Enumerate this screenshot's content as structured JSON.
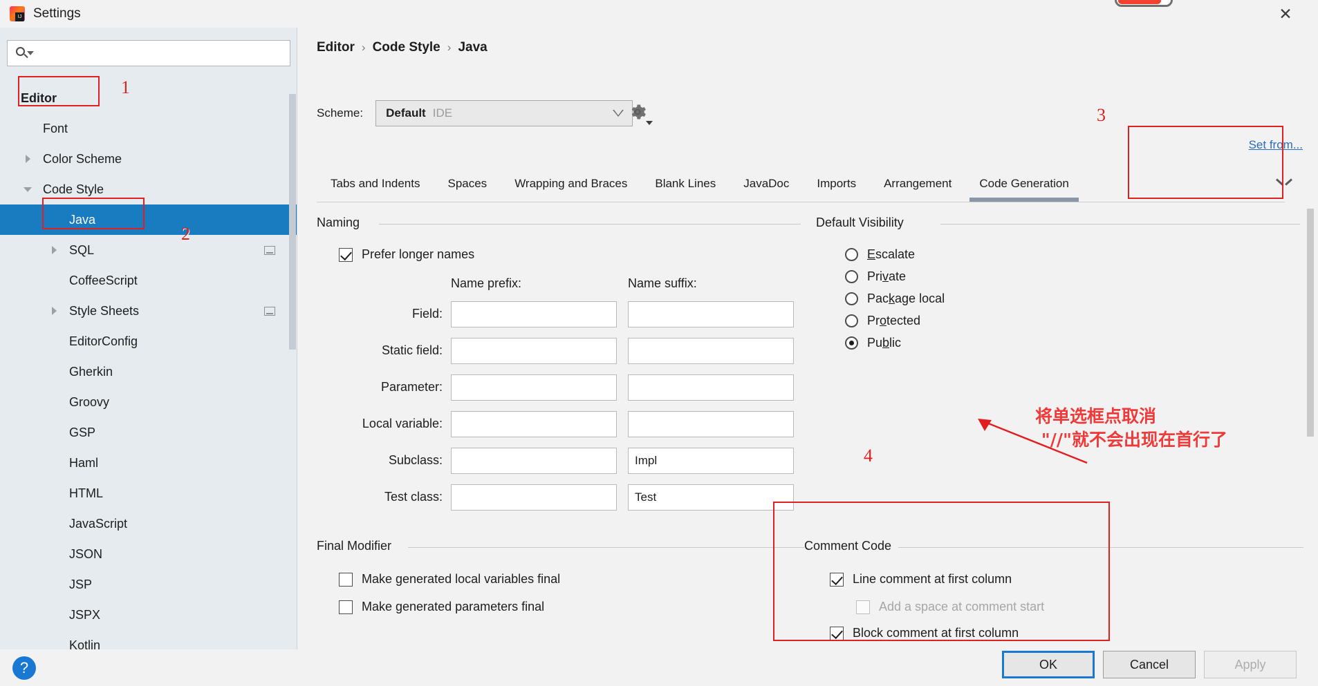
{
  "window": {
    "title": "Settings",
    "logo_icon": "intellij-idea-logo",
    "close_icon": "close-icon"
  },
  "sidebar": {
    "search": {
      "value": "",
      "placeholder": "",
      "icon": "search-icon"
    },
    "items": [
      {
        "label": "Editor",
        "indent": 0,
        "arrow": "none",
        "bold": true,
        "selected": false,
        "glyph": false
      },
      {
        "label": "Font",
        "indent": 1,
        "arrow": "none",
        "bold": false,
        "selected": false,
        "glyph": false
      },
      {
        "label": "Color Scheme",
        "indent": 1,
        "arrow": "right",
        "bold": false,
        "selected": false,
        "glyph": false
      },
      {
        "label": "Code Style",
        "indent": 1,
        "arrow": "down",
        "bold": false,
        "selected": false,
        "glyph": false
      },
      {
        "label": "Java",
        "indent": 2,
        "arrow": "none",
        "bold": false,
        "selected": true,
        "glyph": false
      },
      {
        "label": "SQL",
        "indent": 2,
        "arrow": "right",
        "bold": false,
        "selected": false,
        "glyph": true
      },
      {
        "label": "CoffeeScript",
        "indent": 2,
        "arrow": "none",
        "bold": false,
        "selected": false,
        "glyph": false
      },
      {
        "label": "Style Sheets",
        "indent": 2,
        "arrow": "right",
        "bold": false,
        "selected": false,
        "glyph": true
      },
      {
        "label": "EditorConfig",
        "indent": 2,
        "arrow": "none",
        "bold": false,
        "selected": false,
        "glyph": false
      },
      {
        "label": "Gherkin",
        "indent": 2,
        "arrow": "none",
        "bold": false,
        "selected": false,
        "glyph": false
      },
      {
        "label": "Groovy",
        "indent": 2,
        "arrow": "none",
        "bold": false,
        "selected": false,
        "glyph": false
      },
      {
        "label": "GSP",
        "indent": 2,
        "arrow": "none",
        "bold": false,
        "selected": false,
        "glyph": false
      },
      {
        "label": "Haml",
        "indent": 2,
        "arrow": "none",
        "bold": false,
        "selected": false,
        "glyph": false
      },
      {
        "label": "HTML",
        "indent": 2,
        "arrow": "none",
        "bold": false,
        "selected": false,
        "glyph": false
      },
      {
        "label": "JavaScript",
        "indent": 2,
        "arrow": "none",
        "bold": false,
        "selected": false,
        "glyph": false
      },
      {
        "label": "JSON",
        "indent": 2,
        "arrow": "none",
        "bold": false,
        "selected": false,
        "glyph": false
      },
      {
        "label": "JSP",
        "indent": 2,
        "arrow": "none",
        "bold": false,
        "selected": false,
        "glyph": false
      },
      {
        "label": "JSPX",
        "indent": 2,
        "arrow": "none",
        "bold": false,
        "selected": false,
        "glyph": false
      },
      {
        "label": "Kotlin",
        "indent": 2,
        "arrow": "none",
        "bold": false,
        "selected": false,
        "glyph": false
      }
    ]
  },
  "main": {
    "breadcrumb": [
      "Editor",
      "Code Style",
      "Java"
    ],
    "breadcrumb_separator": "›",
    "scheme": {
      "label": "Scheme:",
      "value": "Default",
      "scope": "IDE",
      "gear_icon": "gear-icon",
      "dropdown_icon": "chevron-down-icon"
    },
    "set_from_link": "Set from...",
    "tabs": [
      {
        "label": "Tabs and Indents",
        "active": false
      },
      {
        "label": "Spaces",
        "active": false
      },
      {
        "label": "Wrapping and Braces",
        "active": false
      },
      {
        "label": "Blank Lines",
        "active": false
      },
      {
        "label": "JavaDoc",
        "active": false
      },
      {
        "label": "Imports",
        "active": false
      },
      {
        "label": "Arrangement",
        "active": false
      },
      {
        "label": "Code Generation",
        "active": true
      }
    ],
    "tabs_overflow_icon": "chevron-down-icon",
    "naming": {
      "group_title": "Naming",
      "prefer_longer_names": {
        "label": "Prefer longer names",
        "checked": true
      },
      "col_prefix": "Name prefix:",
      "col_suffix": "Name suffix:",
      "rows": [
        {
          "label": "Field:",
          "prefix": "",
          "suffix": ""
        },
        {
          "label": "Static field:",
          "prefix": "",
          "suffix": ""
        },
        {
          "label": "Parameter:",
          "prefix": "",
          "suffix": ""
        },
        {
          "label": "Local variable:",
          "prefix": "",
          "suffix": ""
        },
        {
          "label": "Subclass:",
          "prefix": "",
          "suffix": "Impl"
        },
        {
          "label": "Test class:",
          "prefix": "",
          "suffix": "Test"
        }
      ]
    },
    "default_visibility": {
      "group_title": "Default Visibility",
      "options": [
        {
          "label": "Escalate",
          "mnemonic": "E",
          "selected": false
        },
        {
          "label": "Private",
          "mnemonic": "v",
          "selected": false
        },
        {
          "label": "Package local",
          "mnemonic": "k",
          "selected": false
        },
        {
          "label": "Protected",
          "mnemonic": "o",
          "selected": false
        },
        {
          "label": "Public",
          "mnemonic": "b",
          "selected": true
        }
      ]
    },
    "final_modifier": {
      "group_title": "Final Modifier",
      "options": [
        {
          "label": "Make generated local variables final",
          "checked": false
        },
        {
          "label": "Make generated parameters final",
          "checked": false
        }
      ]
    },
    "comment_code": {
      "group_title": "Comment Code",
      "options": [
        {
          "label": "Line comment at first column",
          "checked": true,
          "disabled": false
        },
        {
          "label": "Add a space at comment start",
          "checked": false,
          "disabled": true
        },
        {
          "label": "Block comment at first column",
          "checked": true,
          "disabled": false
        }
      ]
    }
  },
  "annotations": {
    "numbers": [
      "1",
      "2",
      "3",
      "4"
    ],
    "note_line1": "将单选框点取消",
    "note_line2": " \"//\"就不会出现在首行了",
    "accent_color": "#e02020"
  },
  "footer": {
    "help_icon": "help-icon",
    "help_label": "?",
    "ok": "OK",
    "cancel": "Cancel",
    "apply": "Apply"
  }
}
